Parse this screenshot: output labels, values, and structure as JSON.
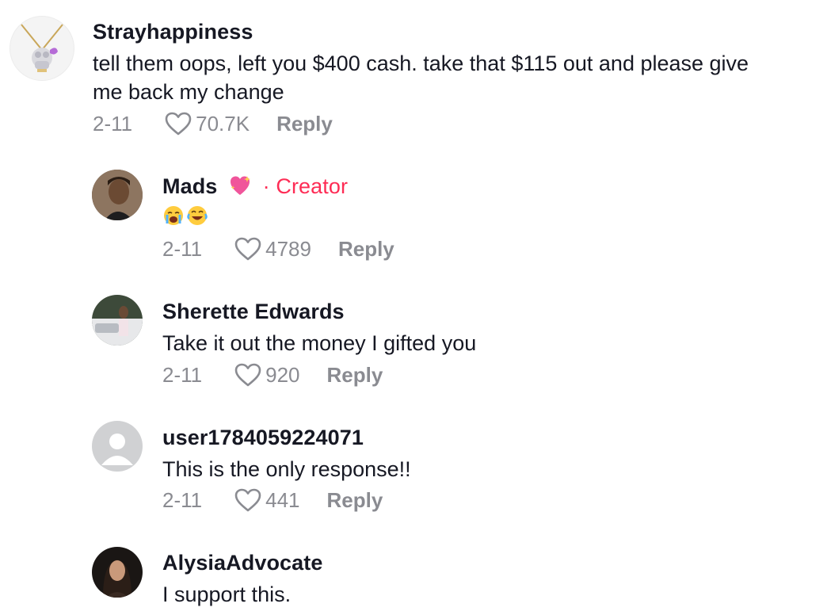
{
  "comments": [
    {
      "username": "Strayhappiness",
      "line1": "tell them oops, left you $400 cash. take that $115 out and please give",
      "line2": "me back my change",
      "date": "2-11",
      "likes": "70.7K",
      "reply": "Reply"
    },
    {
      "username": "Mads",
      "badge_sep": "·",
      "badge": "Creator",
      "date": "2-11",
      "likes": "4789",
      "reply": "Reply"
    },
    {
      "username": "Sherette Edwards",
      "line1": "Take it out the money I gifted you",
      "date": "2-11",
      "likes": "920",
      "reply": "Reply"
    },
    {
      "username": "user1784059224071",
      "line1": "This is the only response!!",
      "date": "2-11",
      "likes": "441",
      "reply": "Reply"
    },
    {
      "username": "AlysiaAdvocate",
      "line1": "I support this."
    }
  ],
  "icons": {
    "like": "heart-outline-icon",
    "name_emoji": "sparkling-heart-emoji",
    "reply_emojis": [
      "loudly-crying-face-emoji",
      "tears-of-joy-emoji"
    ]
  },
  "colors": {
    "text": "#161823",
    "secondary": "#8a8b91",
    "creator": "#fe2c55"
  }
}
